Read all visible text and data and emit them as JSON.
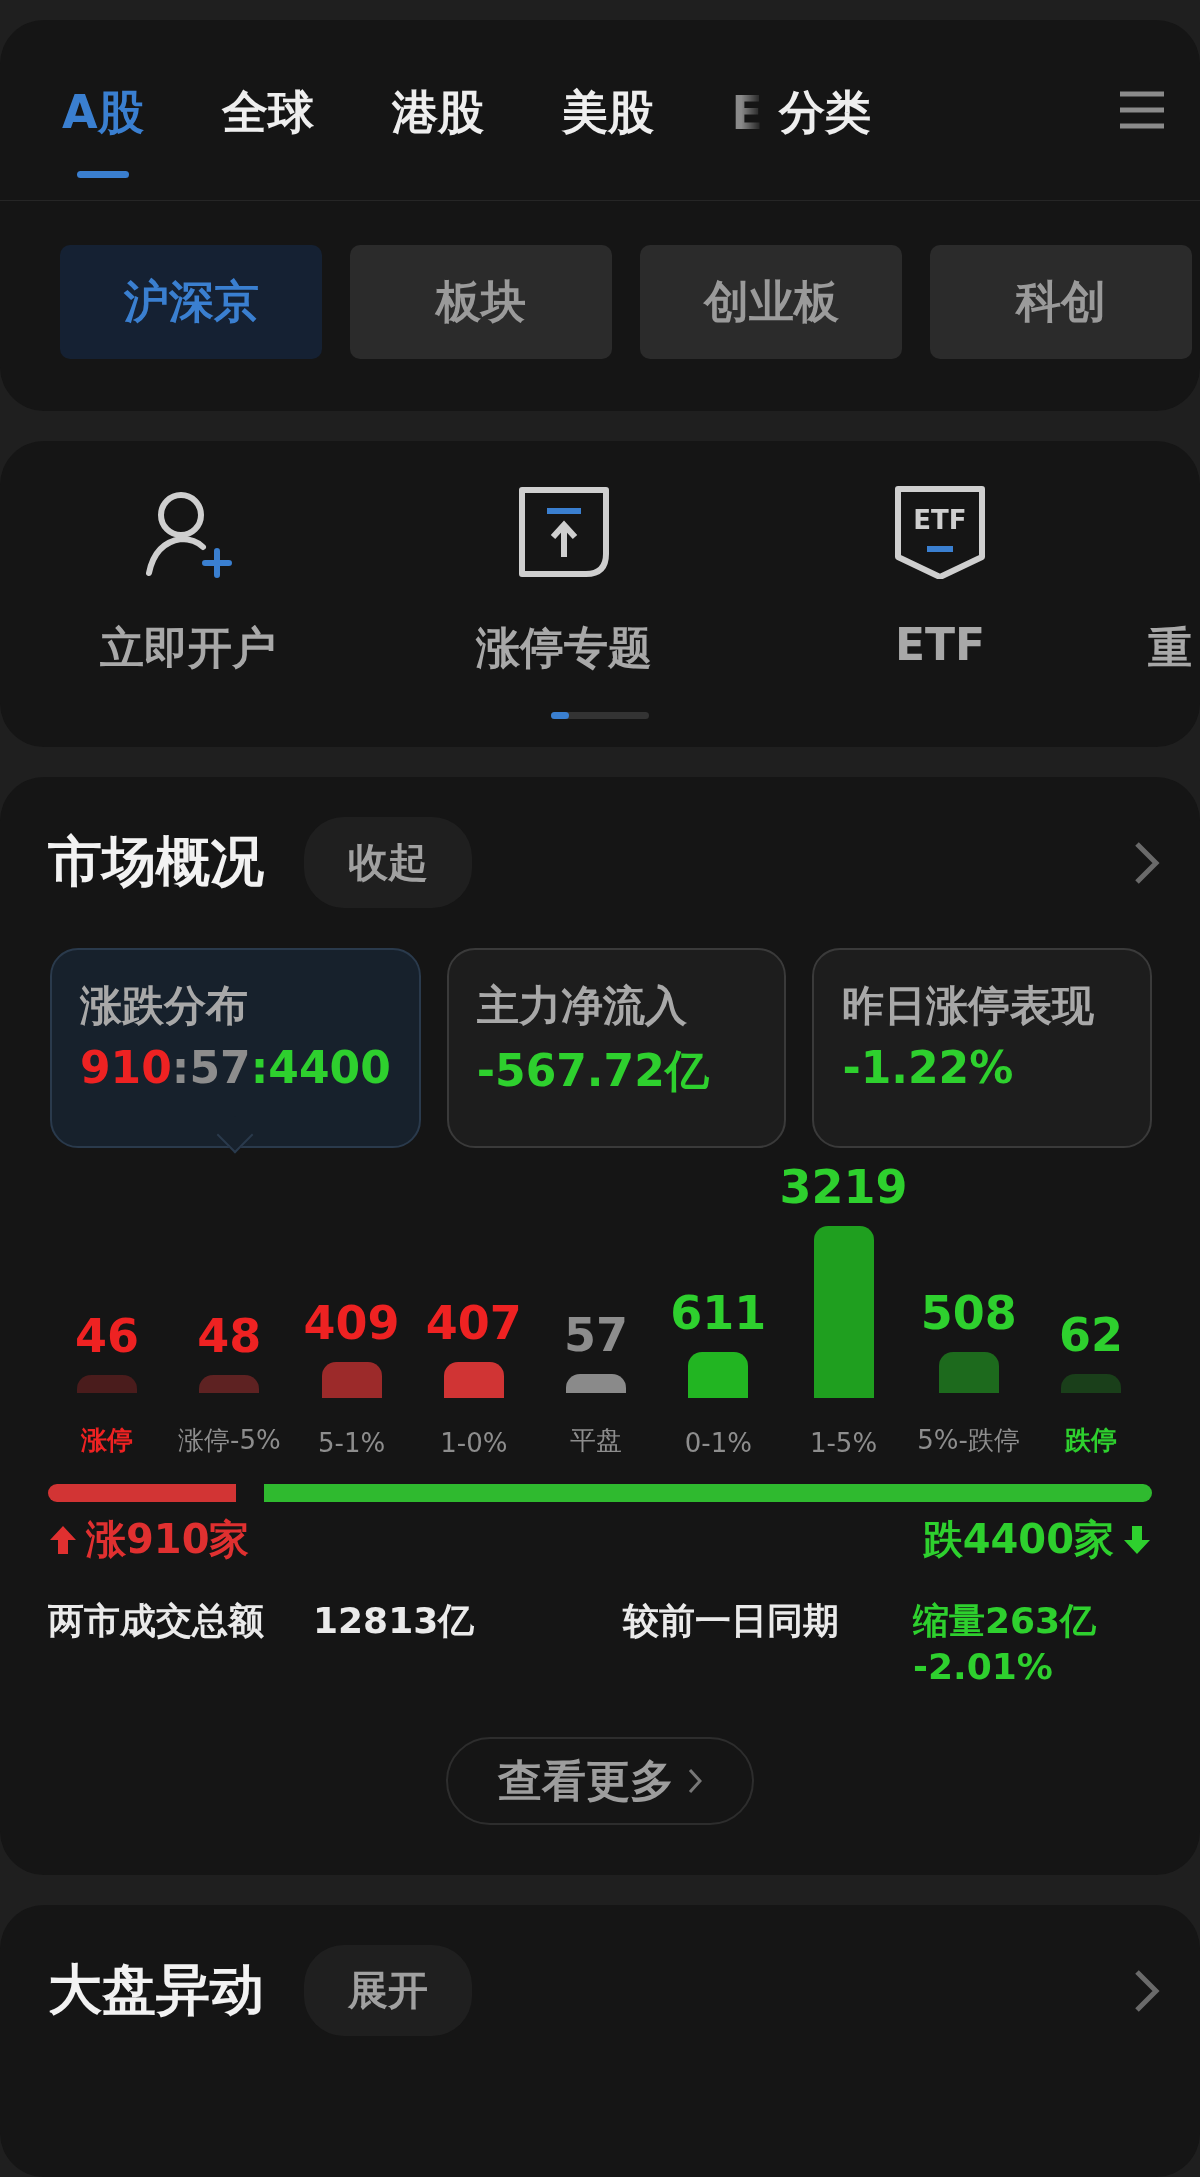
{
  "market_tabs": [
    {
      "label": "A股",
      "selected": true,
      "kind": "tab"
    },
    {
      "label": "全球",
      "selected": false,
      "kind": "tab"
    },
    {
      "label": "港股",
      "selected": false,
      "kind": "tab"
    },
    {
      "label": "美股",
      "selected": false,
      "kind": "tab"
    },
    {
      "label": "E",
      "selected": false,
      "kind": "cut"
    },
    {
      "label": "分类",
      "selected": false,
      "kind": "tab"
    }
  ],
  "board_tabs": [
    {
      "label": "沪深京",
      "selected": true
    },
    {
      "label": "板块",
      "selected": false
    },
    {
      "label": "创业板",
      "selected": false
    },
    {
      "label": "科创",
      "selected": false
    }
  ],
  "shortcuts": [
    {
      "label": "立即开户",
      "kind": "user-add"
    },
    {
      "label": "涨停专题",
      "kind": "limit-up"
    },
    {
      "label": "ETF",
      "kind": "etf",
      "icon_text": "ETF"
    },
    {
      "label": "重",
      "kind": "none"
    }
  ],
  "market_overview": {
    "title": "市场概况",
    "toggle": "收起",
    "stats": [
      {
        "label": "涨跌分布",
        "selected": true,
        "value_parts": [
          {
            "text": "910",
            "kind": "up"
          },
          {
            "text": ":57",
            "kind": "flat"
          },
          {
            "text": ":4400",
            "kind": "down"
          }
        ]
      },
      {
        "label": "主力净流入",
        "selected": false,
        "value_parts": [
          {
            "text": "-567.72亿",
            "kind": "down"
          }
        ]
      },
      {
        "label": "昨日涨停表现",
        "selected": false,
        "value_parts": [
          {
            "text": "-1.22%",
            "kind": "down"
          }
        ]
      }
    ],
    "distribution": [
      {
        "count": "46",
        "category": "涨停",
        "kind": "up",
        "limit": true,
        "color": "#4a1c1c"
      },
      {
        "count": "48",
        "category": "涨停-5%",
        "kind": "up",
        "limit": false,
        "color": "#5e2222"
      },
      {
        "count": "409",
        "category": "5-1%",
        "kind": "up",
        "limit": false,
        "color": "#9c2a2a"
      },
      {
        "count": "407",
        "category": "1-0%",
        "kind": "up",
        "limit": false,
        "color": "#d03434"
      },
      {
        "count": "57",
        "category": "平盘",
        "kind": "flat",
        "limit": false,
        "color": "#8a8a8a"
      },
      {
        "count": "611",
        "category": "0-1%",
        "kind": "down",
        "limit": false,
        "color": "#22b522"
      },
      {
        "count": "3219",
        "category": "1-5%",
        "kind": "down",
        "limit": false,
        "color": "#1f9f1f"
      },
      {
        "count": "508",
        "category": "5%-跌停",
        "kind": "down",
        "limit": false,
        "color": "#1d6a1d"
      },
      {
        "count": "62",
        "category": "跌停",
        "kind": "down",
        "limit": true,
        "color": "#1a3f1a"
      }
    ],
    "ratio_bar": {
      "level": 0.17
    },
    "up_count": "涨910家",
    "down_count": "跌4400家",
    "turnover_label": "两市成交总额",
    "turnover_value": "12813亿",
    "compare_label": "较前一日同期",
    "compare_value": "缩量263亿",
    "compare_change": "-2.01%",
    "more_button": "查看更多"
  },
  "market_moves": {
    "title": "大盘异动",
    "toggle": "展开"
  }
}
